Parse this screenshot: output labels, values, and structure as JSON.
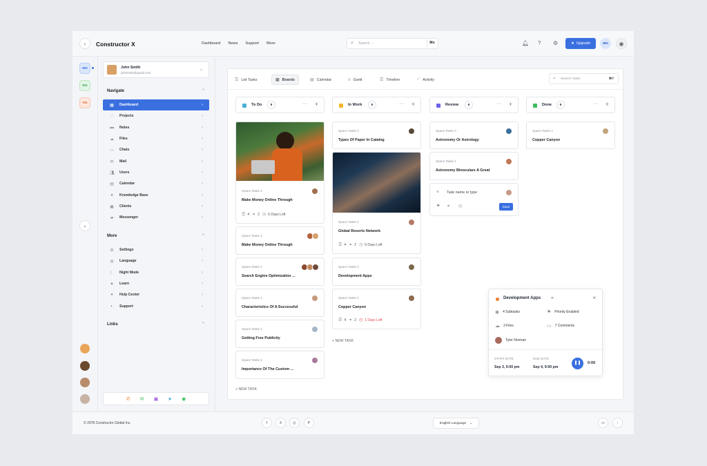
{
  "app": {
    "brand": "Constructor X",
    "nav": [
      "Dashboard",
      "News",
      "Support",
      "More"
    ],
    "search_placeholder": "Search ...",
    "search_shortcut": "⌘K",
    "upgrade_label": "Upgrade",
    "user_initials": "MH",
    "accent": "#3a6fe0"
  },
  "rail": {
    "workspaces": [
      "MH",
      "DG",
      "VG"
    ]
  },
  "user": {
    "name": "John Smith",
    "email": "johnsmith@gmail.com"
  },
  "sidebar": {
    "navigate_title": "Navigate",
    "navigate": [
      {
        "label": "Dashboard",
        "icon": "grid-icon"
      },
      {
        "label": "Projects",
        "icon": "grid-dots-icon"
      },
      {
        "label": "Notes",
        "icon": "folder-icon"
      },
      {
        "label": "Files",
        "icon": "cloud-icon"
      },
      {
        "label": "Chats",
        "icon": "chat-icon"
      },
      {
        "label": "Mail",
        "icon": "mail-icon"
      },
      {
        "label": "Users",
        "icon": "users-icon"
      },
      {
        "label": "Calendar",
        "icon": "calendar-icon"
      },
      {
        "label": "Knowledge Base",
        "icon": "info-icon"
      },
      {
        "label": "Clients",
        "icon": "contact-card-icon"
      },
      {
        "label": "Messenger",
        "icon": "messenger-icon"
      }
    ],
    "more_title": "More",
    "more": [
      {
        "label": "Settings",
        "icon": "gear-icon"
      },
      {
        "label": "Language",
        "icon": "globe-icon"
      },
      {
        "label": "Night Mode",
        "icon": "moon-icon"
      },
      {
        "label": "Learn",
        "icon": "graduation-cap-icon"
      },
      {
        "label": "Help Center",
        "icon": "help-icon"
      },
      {
        "label": "Support",
        "icon": "support-icon"
      }
    ],
    "links_title": "Links"
  },
  "views": {
    "tabs": [
      "List Tasks",
      "Boards",
      "Calendar",
      "Gantt",
      "Timeline",
      "Activity"
    ],
    "active": "Boards",
    "search_placeholder": "Search Tasks",
    "search_shortcut": "⌘T"
  },
  "board": {
    "columns": [
      {
        "title": "To Do",
        "count": "5",
        "color": "#4bb0d8"
      },
      {
        "title": "In Work",
        "count": "5",
        "color": "#f2b52e"
      },
      {
        "title": "Review",
        "count": "5",
        "color": "#6a63e8"
      },
      {
        "title": "Done",
        "count": "5",
        "color": "#3ebd5a"
      }
    ],
    "todo": [
      {
        "space": "Space Tasks 3",
        "title": "Make Money Online Through",
        "subtasks": "4",
        "links": "2",
        "due": "6 Days Left"
      },
      {
        "space": "Space Tasks 2",
        "title": "Make Money Online Through"
      },
      {
        "space": "Space Tasks 2",
        "title": "Search Engine Optimization ..."
      },
      {
        "space": "Space Tasks 2",
        "title": "Characteristics Of A Successful"
      },
      {
        "space": "Space Tasks 2",
        "title": "Getting Free Publicity"
      },
      {
        "space": "Space Tasks 2",
        "title": "Importance Of The Custom ..."
      }
    ],
    "inwork": [
      {
        "space": "Space Tasks 2",
        "title": "Types Of Paper In Catalog"
      },
      {
        "space": "Space Tasks 2",
        "title": "Global Resorts Network",
        "subtasks": "4",
        "links": "2",
        "due": "6 Days Left"
      },
      {
        "space": "Space Tasks 2",
        "title": "Development Apps"
      },
      {
        "space": "Space Tasks 2",
        "title": "Copper Canyon",
        "subtasks": "4",
        "links": "2",
        "due": "1 Days Left"
      }
    ],
    "review": [
      {
        "space": "Space Tasks 3",
        "title": "Astronomy Or Astrology"
      },
      {
        "space": "Space Tasks 1",
        "title": "Astronomy Binoculars A Great"
      }
    ],
    "review_input": {
      "placeholder": "Task name or type",
      "save_label": "Save"
    },
    "done": [
      {
        "space": "Space Tasks 2",
        "title": "Copper Canyon"
      }
    ],
    "new_task_label": "+ NEW TASK"
  },
  "popup": {
    "title": "Development Apps",
    "subtasks": "4 Subtasks",
    "priority": "Priority Enabled",
    "files": "3 Files",
    "comments": "7 Comments",
    "assignee": "Tyler Norman",
    "start_label": "START DATE",
    "start_value": "Sep 3, 9:00 pm",
    "due_label": "DUE DATE",
    "due_value": "Sep 4, 9:00 pm",
    "timer": "0:00"
  },
  "footer": {
    "copyright": "© 2078 Constructor Global Inc.",
    "language": "English Language"
  }
}
